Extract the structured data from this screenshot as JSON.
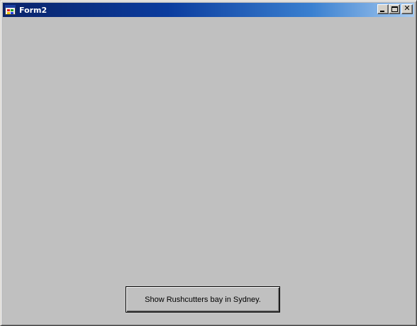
{
  "window": {
    "title": "Form2",
    "icon": "form-window-icon",
    "controls": {
      "minimize": "minimize-icon",
      "maximize": "maximize-icon",
      "close": "close-icon",
      "close_glyph": "✕"
    }
  },
  "form": {
    "background_color": "#c0c0c0",
    "button_label": "Show Rushcutters bay in Sydney."
  }
}
